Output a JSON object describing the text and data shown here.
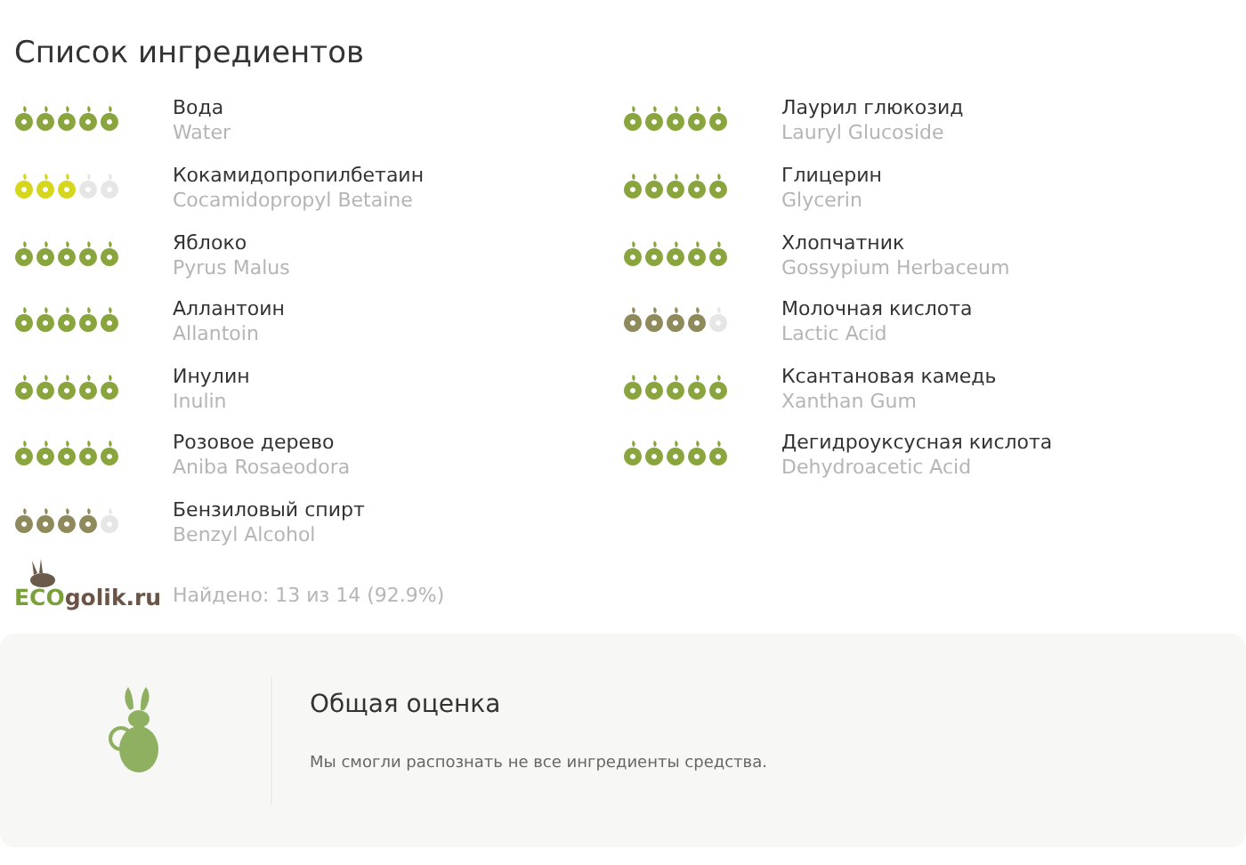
{
  "title": "Список ингредиентов",
  "columns": [
    {
      "items": [
        {
          "name": "Вода",
          "latin": "Water",
          "stars": 5,
          "color": "#8aa53e"
        },
        {
          "name": "Кокамидопропилбетаин",
          "latin": "Cocamidopropyl Betaine",
          "stars": 3,
          "color": "#d6d61c"
        },
        {
          "name": "Яблоко",
          "latin": "Pyrus Malus",
          "stars": 5,
          "color": "#8aa53e"
        },
        {
          "name": "Аллантоин",
          "latin": "Allantoin",
          "stars": 5,
          "color": "#8aa53e"
        },
        {
          "name": "Инулин",
          "latin": "Inulin",
          "stars": 5,
          "color": "#8aa53e"
        },
        {
          "name": "Розовое дерево",
          "latin": "Aniba Rosaeodora",
          "stars": 5,
          "color": "#8aa53e"
        },
        {
          "name": "Бензиловый спирт",
          "latin": "Benzyl Alcohol",
          "stars": 4,
          "color": "#8f8a5c"
        }
      ]
    },
    {
      "items": [
        {
          "name": "Лаурил глюкозид",
          "latin": "Lauryl Glucoside",
          "stars": 5,
          "color": "#8aa53e"
        },
        {
          "name": "Глицерин",
          "latin": "Glycerin",
          "stars": 5,
          "color": "#8aa53e"
        },
        {
          "name": "Хлопчатник",
          "latin": "Gossypium Herbaceum",
          "stars": 5,
          "color": "#8aa53e"
        },
        {
          "name": "Молочная кислота",
          "latin": "Lactic Acid",
          "stars": 4,
          "color": "#8f8a5c"
        },
        {
          "name": "Ксантановая камедь",
          "latin": "Xanthan Gum",
          "stars": 5,
          "color": "#8aa53e"
        },
        {
          "name": "Дегидроуксусная кислота",
          "latin": "Dehydroacetic Acid",
          "stars": 5,
          "color": "#8aa53e"
        }
      ]
    }
  ],
  "logo": {
    "eco": "ECO",
    "rest": "golik.ru"
  },
  "found": "Найдено: 13 из 14 (92.9%)",
  "summary": {
    "heading": "Общая оценка",
    "text": "Мы смогли распознать не все ингредиенты средства."
  }
}
